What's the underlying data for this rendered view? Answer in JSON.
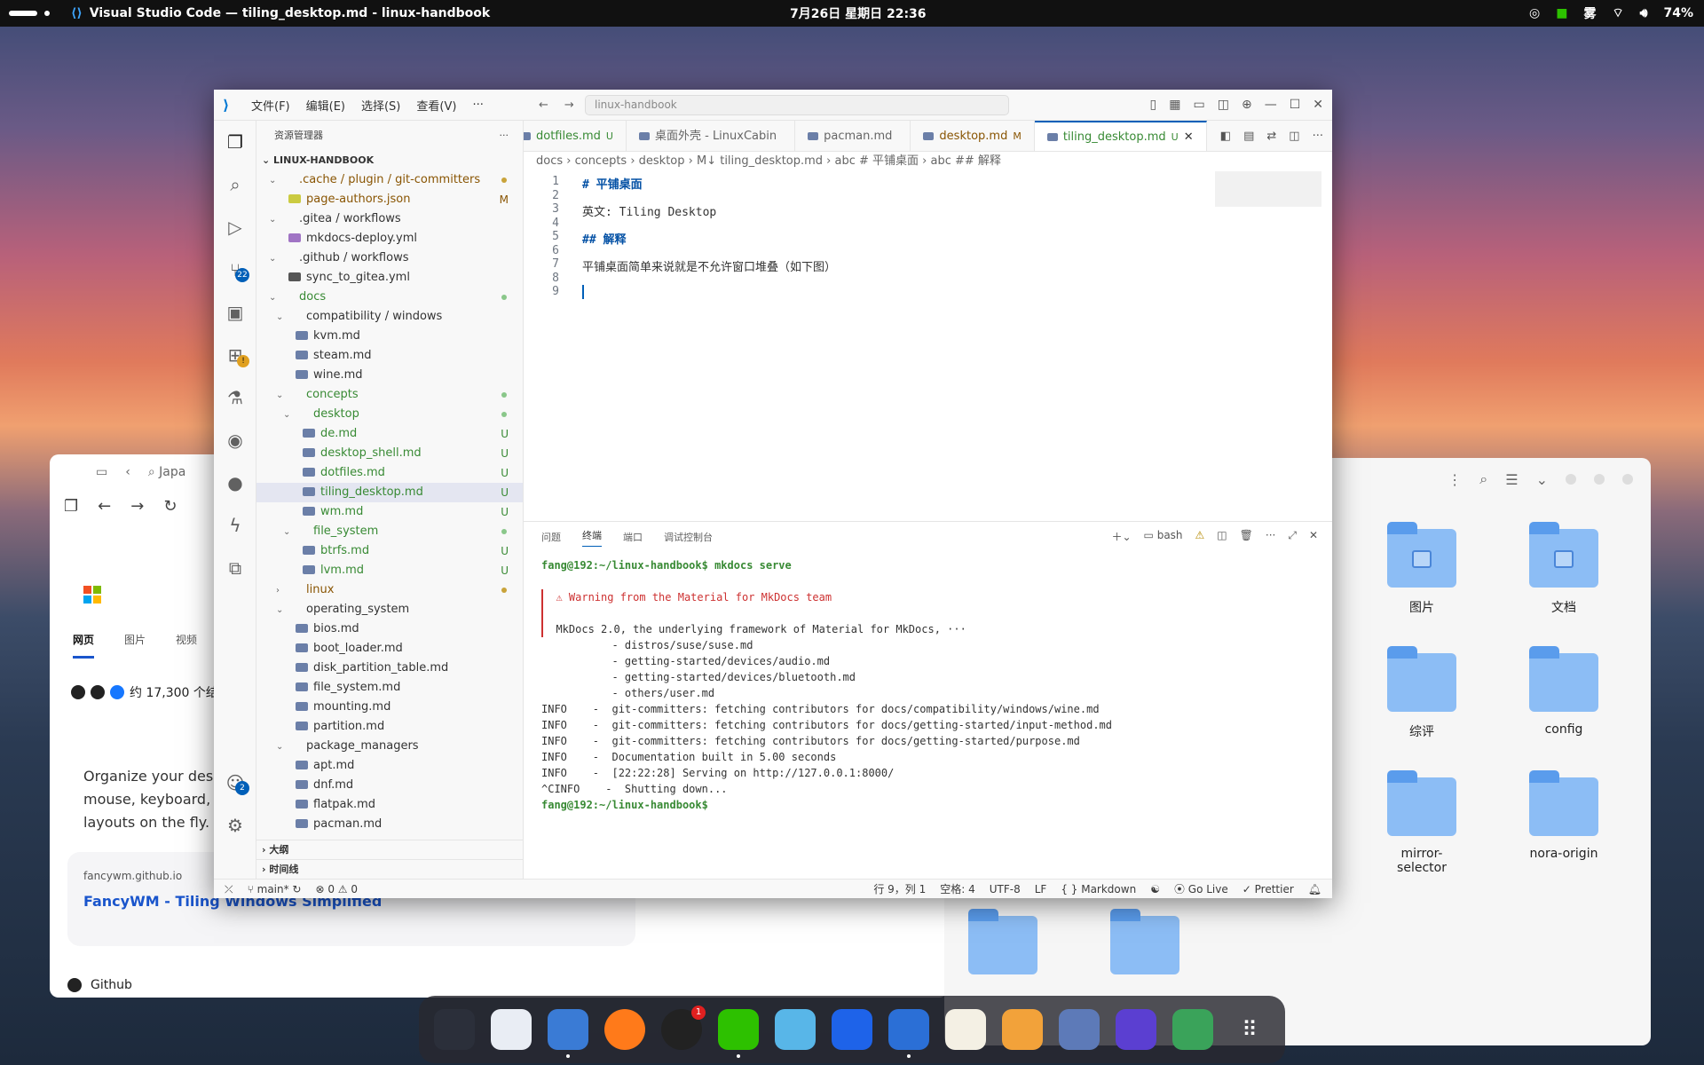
{
  "topbar": {
    "window_title": "Visual Studio Code — tiling_desktop.md - linux-handbook",
    "clock": "7月26日 星期日 22:36",
    "ime": "雾",
    "battery": "74%"
  },
  "colors": {
    "vscode_accent": "#005fb8",
    "terminal_prompt": "#388a34",
    "heading": "#0451a5",
    "warning": "#cd3131"
  },
  "browser": {
    "search_text": "Japa",
    "tab_web": "网页",
    "tab_images": "图片",
    "tab_video": "视频",
    "results_count": "约 17,300 个结",
    "description": "Organize your desktop mouse, keyboard, or layouts on the fly.",
    "site": "fancywm.github.io",
    "link": "FancyWM - Tiling Windows Simplified",
    "github_label": "Github"
  },
  "files": {
    "folders": [
      "图片",
      "文档",
      "综评",
      "config",
      "mirror-selector",
      "nora-origin"
    ]
  },
  "vscode": {
    "menu": [
      "文件(F)",
      "编辑(E)",
      "选择(S)",
      "查看(V)",
      "···"
    ],
    "command_center": "linux-handbook",
    "explorer_title": "资源管理器",
    "root": "LINUX-HANDBOOK",
    "tree": [
      {
        "label": ".cache / plugin / git-committers",
        "depth": 0,
        "type": "folder",
        "open": true,
        "state": "mod",
        "dot": true
      },
      {
        "label": "page-authors.json",
        "depth": 1,
        "type": "json",
        "state": "mod",
        "badge": "M"
      },
      {
        "label": ".gitea / workflows",
        "depth": 0,
        "type": "folder",
        "open": true,
        "state": ""
      },
      {
        "label": "mkdocs-deploy.yml",
        "depth": 1,
        "type": "yml",
        "state": ""
      },
      {
        "label": ".github / workflows",
        "depth": 0,
        "type": "folder",
        "open": true,
        "state": ""
      },
      {
        "label": "sync_to_gitea.yml",
        "depth": 1,
        "type": "gh",
        "state": ""
      },
      {
        "label": "docs",
        "depth": 0,
        "type": "folder",
        "open": true,
        "state": "add",
        "dot": true
      },
      {
        "label": "compatibility / windows",
        "depth": 1,
        "type": "folder",
        "open": true,
        "state": ""
      },
      {
        "label": "kvm.md",
        "depth": 2,
        "type": "md",
        "state": ""
      },
      {
        "label": "steam.md",
        "depth": 2,
        "type": "md",
        "state": ""
      },
      {
        "label": "wine.md",
        "depth": 2,
        "type": "md",
        "state": ""
      },
      {
        "label": "concepts",
        "depth": 1,
        "type": "folder",
        "open": true,
        "state": "add",
        "dot": true
      },
      {
        "label": "desktop",
        "depth": 2,
        "type": "folder",
        "open": true,
        "state": "add",
        "dot": true
      },
      {
        "label": "de.md",
        "depth": 3,
        "type": "md",
        "state": "add",
        "badge": "U"
      },
      {
        "label": "desktop_shell.md",
        "depth": 3,
        "type": "md",
        "state": "add",
        "badge": "U"
      },
      {
        "label": "dotfiles.md",
        "depth": 3,
        "type": "md",
        "state": "add",
        "badge": "U"
      },
      {
        "label": "tiling_desktop.md",
        "depth": 3,
        "type": "md",
        "state": "add",
        "badge": "U",
        "selected": true
      },
      {
        "label": "wm.md",
        "depth": 3,
        "type": "md",
        "state": "add",
        "badge": "U"
      },
      {
        "label": "file_system",
        "depth": 2,
        "type": "folder",
        "open": true,
        "state": "add",
        "dot": true
      },
      {
        "label": "btrfs.md",
        "depth": 3,
        "type": "md",
        "state": "add",
        "badge": "U"
      },
      {
        "label": "lvm.md",
        "depth": 3,
        "type": "md",
        "state": "add",
        "badge": "U"
      },
      {
        "label": "linux",
        "depth": 1,
        "type": "folder",
        "open": false,
        "state": "mod",
        "dot": true
      },
      {
        "label": "operating_system",
        "depth": 1,
        "type": "folder",
        "open": true,
        "state": ""
      },
      {
        "label": "bios.md",
        "depth": 2,
        "type": "md",
        "state": ""
      },
      {
        "label": "boot_loader.md",
        "depth": 2,
        "type": "md",
        "state": ""
      },
      {
        "label": "disk_partition_table.md",
        "depth": 2,
        "type": "md",
        "state": ""
      },
      {
        "label": "file_system.md",
        "depth": 2,
        "type": "md",
        "state": ""
      },
      {
        "label": "mounting.md",
        "depth": 2,
        "type": "md",
        "state": ""
      },
      {
        "label": "partition.md",
        "depth": 2,
        "type": "md",
        "state": ""
      },
      {
        "label": "package_managers",
        "depth": 1,
        "type": "folder",
        "open": true,
        "state": ""
      },
      {
        "label": "apt.md",
        "depth": 2,
        "type": "md",
        "state": ""
      },
      {
        "label": "dnf.md",
        "depth": 2,
        "type": "md",
        "state": ""
      },
      {
        "label": "flatpak.md",
        "depth": 2,
        "type": "md",
        "state": ""
      },
      {
        "label": "pacman.md",
        "depth": 2,
        "type": "md",
        "state": ""
      }
    ],
    "outline": "大纲",
    "timeline": "时间线",
    "activity_badges": {
      "scm": "22",
      "account": "2"
    },
    "tabs": [
      {
        "label": "dotfiles.md",
        "mark": "U",
        "state": "add"
      },
      {
        "label": "桌面外壳 - LinuxCabin",
        "mark": "",
        "state": ""
      },
      {
        "label": "pacman.md",
        "mark": "",
        "state": ""
      },
      {
        "label": "desktop.md",
        "mark": "M",
        "state": "mod"
      },
      {
        "label": "tiling_desktop.md",
        "mark": "U",
        "state": "add",
        "active": true
      }
    ],
    "breadcrumb": "docs › concepts › desktop › M↓ tiling_desktop.md › abc # 平铺桌面 › abc ## 解释",
    "code_lines": [
      "# 平铺桌面",
      "",
      "英文: Tiling Desktop",
      "",
      "## 解释",
      "",
      "平铺桌面简单来说就是不允许窗口堆叠（如下图）",
      "",
      ""
    ],
    "panel_tabs": [
      "问题",
      "终端",
      "端口",
      "调试控制台"
    ],
    "panel_shell": "bash",
    "terminal": [
      {
        "text": "fang@192:~/linux-handbook$ mkdocs serve",
        "kind": "prompt"
      },
      {
        "text": "",
        "kind": ""
      },
      {
        "text": "  ⚠ Warning from the Material for MkDocs team",
        "kind": "warn"
      },
      {
        "text": "",
        "kind": ""
      },
      {
        "text": "  MkDocs 2.0, the underlying framework of Material for MkDocs, ···",
        "kind": ""
      },
      {
        "text": "           - distros/suse/suse.md",
        "kind": ""
      },
      {
        "text": "           - getting-started/devices/audio.md",
        "kind": ""
      },
      {
        "text": "           - getting-started/devices/bluetooth.md",
        "kind": ""
      },
      {
        "text": "           - others/user.md",
        "kind": ""
      },
      {
        "text": "INFO    -  git-committers: fetching contributors for docs/compatibility/windows/wine.md",
        "kind": ""
      },
      {
        "text": "INFO    -  git-committers: fetching contributors for docs/getting-started/input-method.md",
        "kind": ""
      },
      {
        "text": "INFO    -  git-committers: fetching contributors for docs/getting-started/purpose.md",
        "kind": ""
      },
      {
        "text": "INFO    -  Documentation built in 5.00 seconds",
        "kind": ""
      },
      {
        "text": "INFO    -  [22:22:28] Serving on http://127.0.0.1:8000/",
        "kind": ""
      },
      {
        "text": "^CINFO    -  Shutting down...",
        "kind": ""
      },
      {
        "text": "fang@192:~/linux-handbook$ ",
        "kind": "prompt"
      }
    ],
    "status": {
      "branch": "main*",
      "problems": "⊗ 0 ⚠ 0",
      "position": "行 9，列 1",
      "spaces": "空格: 4",
      "encoding": "UTF-8",
      "eol": "LF",
      "language": "{ } Markdown",
      "golive": "Go Live",
      "prettier": "Prettier"
    }
  }
}
